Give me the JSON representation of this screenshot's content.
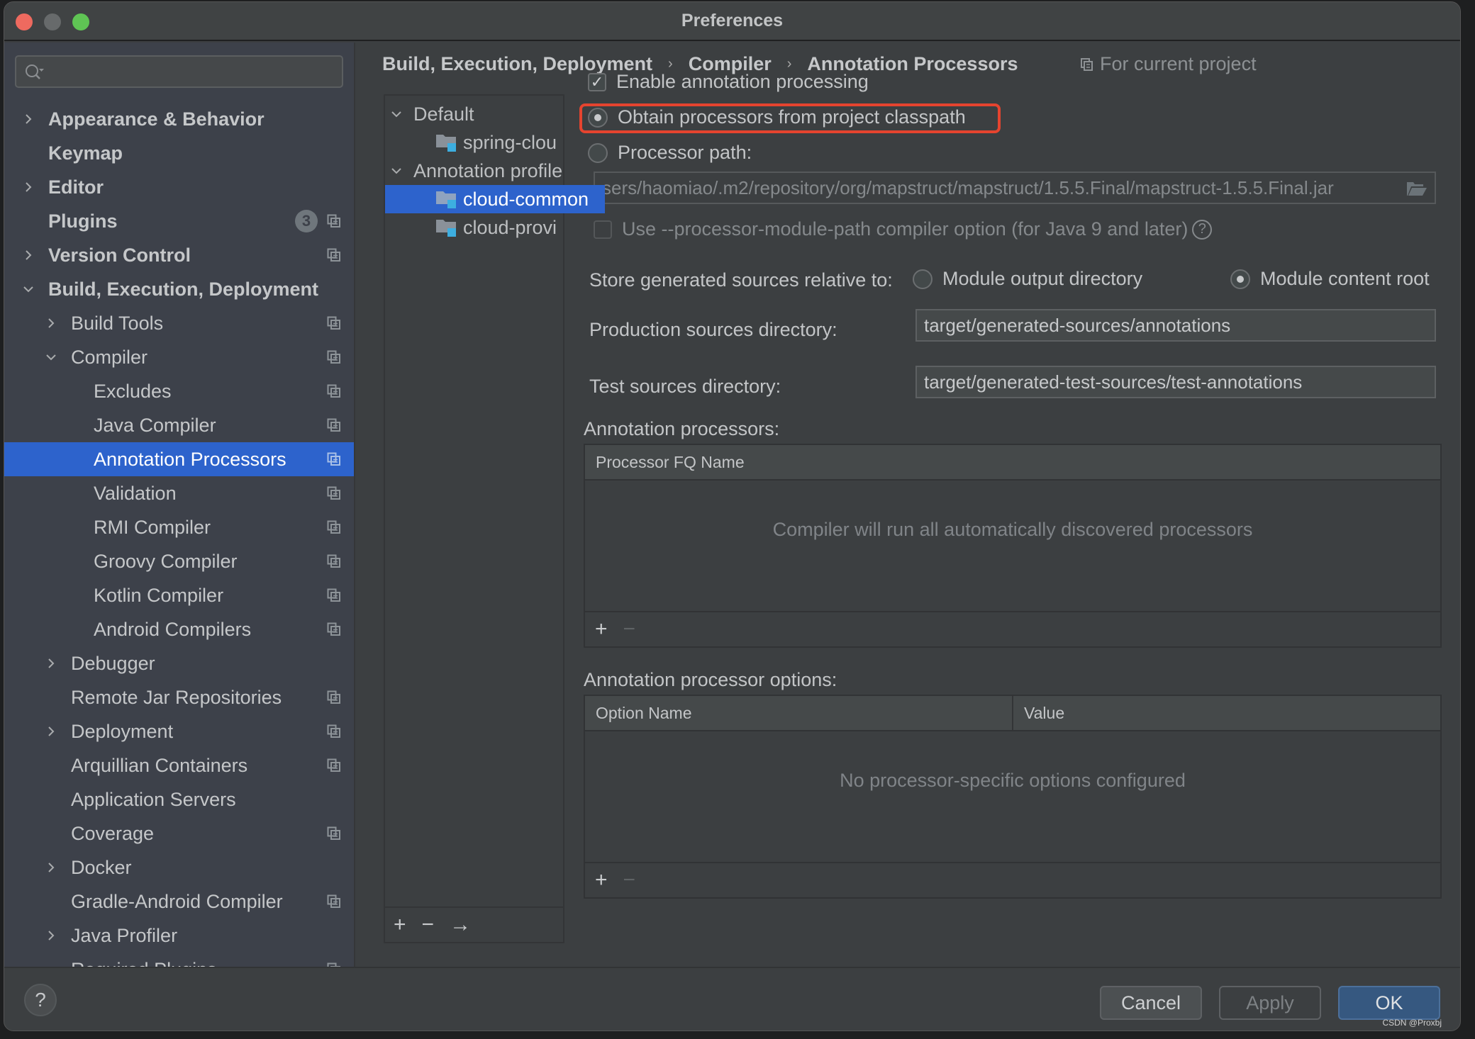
{
  "window": {
    "title": "Preferences"
  },
  "sidebar": {
    "search_placeholder": "",
    "items": [
      {
        "label": "Appearance & Behavior",
        "level": 0,
        "expander": "collapsed",
        "bold": true,
        "project_icon": false
      },
      {
        "label": "Keymap",
        "level": 0,
        "expander": "none",
        "bold": true,
        "project_icon": false
      },
      {
        "label": "Editor",
        "level": 0,
        "expander": "collapsed",
        "bold": true,
        "project_icon": false
      },
      {
        "label": "Plugins",
        "level": 0,
        "expander": "none",
        "bold": true,
        "project_icon": true,
        "badge": "3"
      },
      {
        "label": "Version Control",
        "level": 0,
        "expander": "collapsed",
        "bold": true,
        "project_icon": true
      },
      {
        "label": "Build, Execution, Deployment",
        "level": 0,
        "expander": "expanded",
        "bold": true,
        "project_icon": false
      },
      {
        "label": "Build Tools",
        "level": 1,
        "expander": "collapsed",
        "project_icon": true
      },
      {
        "label": "Compiler",
        "level": 1,
        "expander": "expanded",
        "project_icon": true
      },
      {
        "label": "Excludes",
        "level": 2,
        "expander": "none",
        "project_icon": true
      },
      {
        "label": "Java Compiler",
        "level": 2,
        "expander": "none",
        "project_icon": true
      },
      {
        "label": "Annotation Processors",
        "level": 2,
        "expander": "none",
        "project_icon": true,
        "selected": true
      },
      {
        "label": "Validation",
        "level": 2,
        "expander": "none",
        "project_icon": true
      },
      {
        "label": "RMI Compiler",
        "level": 2,
        "expander": "none",
        "project_icon": true
      },
      {
        "label": "Groovy Compiler",
        "level": 2,
        "expander": "none",
        "project_icon": true
      },
      {
        "label": "Kotlin Compiler",
        "level": 2,
        "expander": "none",
        "project_icon": true
      },
      {
        "label": "Android Compilers",
        "level": 2,
        "expander": "none",
        "project_icon": true
      },
      {
        "label": "Debugger",
        "level": 1,
        "expander": "collapsed",
        "project_icon": false
      },
      {
        "label": "Remote Jar Repositories",
        "level": 1,
        "expander": "none",
        "project_icon": true
      },
      {
        "label": "Deployment",
        "level": 1,
        "expander": "collapsed",
        "project_icon": true
      },
      {
        "label": "Arquillian Containers",
        "level": 1,
        "expander": "none",
        "project_icon": true
      },
      {
        "label": "Application Servers",
        "level": 1,
        "expander": "none",
        "project_icon": false
      },
      {
        "label": "Coverage",
        "level": 1,
        "expander": "none",
        "project_icon": true
      },
      {
        "label": "Docker",
        "level": 1,
        "expander": "collapsed",
        "project_icon": false
      },
      {
        "label": "Gradle-Android Compiler",
        "level": 1,
        "expander": "none",
        "project_icon": true
      },
      {
        "label": "Java Profiler",
        "level": 1,
        "expander": "collapsed",
        "project_icon": false
      },
      {
        "label": "Required Plugins",
        "level": 1,
        "expander": "none",
        "project_icon": true
      }
    ]
  },
  "breadcrumb": {
    "items": [
      "Build, Execution, Deployment",
      "Compiler",
      "Annotation Processors"
    ],
    "scope_label": "For current project"
  },
  "profiles": {
    "groups": [
      {
        "label": "Default",
        "expanded": true,
        "modules": [
          {
            "label": "spring-clou",
            "selected": false
          }
        ]
      },
      {
        "label": "Annotation profile",
        "expanded": true,
        "modules": [
          {
            "label": "cloud-common",
            "selected": true
          },
          {
            "label": "cloud-provi",
            "selected": false
          }
        ]
      }
    ],
    "toolbar": {
      "add": "+",
      "remove": "−",
      "move": "→"
    }
  },
  "settings": {
    "enable_processing": {
      "label": "Enable annotation processing",
      "checked": true
    },
    "source_options": [
      {
        "label": "Obtain processors from project classpath",
        "selected": true,
        "highlighted": true
      },
      {
        "label": "Processor path:",
        "selected": false
      }
    ],
    "processor_path_value": "sers/haomiao/.m2/repository/org/mapstruct/mapstruct/1.5.5.Final/mapstruct-1.5.5.Final.jar",
    "module_path_option": {
      "label": "Use --processor-module-path compiler option (for Java 9 and later)",
      "checked": false,
      "enabled": false
    },
    "store_generated": {
      "label": "Store generated sources relative to:",
      "options": [
        {
          "label": "Module output directory",
          "selected": false
        },
        {
          "label": "Module content root",
          "selected": true
        }
      ]
    },
    "production_dir": {
      "label": "Production sources directory:",
      "value": "target/generated-sources/annotations"
    },
    "test_dir": {
      "label": "Test sources directory:",
      "value": "target/generated-test-sources/test-annotations"
    },
    "processors_table": {
      "title": "Annotation processors:",
      "columns": [
        "Processor FQ Name"
      ],
      "rows": [],
      "empty_text": "Compiler will run all automatically discovered processors",
      "add": "+",
      "remove": "−"
    },
    "options_table": {
      "title": "Annotation processor options:",
      "columns": [
        "Option Name",
        "Value"
      ],
      "rows": [],
      "empty_text": "No processor-specific options configured",
      "add": "+",
      "remove": "−"
    }
  },
  "footer": {
    "help": "?",
    "cancel": "Cancel",
    "apply": "Apply",
    "ok": "OK",
    "watermark": "CSDN @Proxbj"
  },
  "colors": {
    "selection": "#2d63cc",
    "highlight_outline": "#e5442f",
    "ok_button": "#365880",
    "module_icon_accent": "#3daee0"
  }
}
